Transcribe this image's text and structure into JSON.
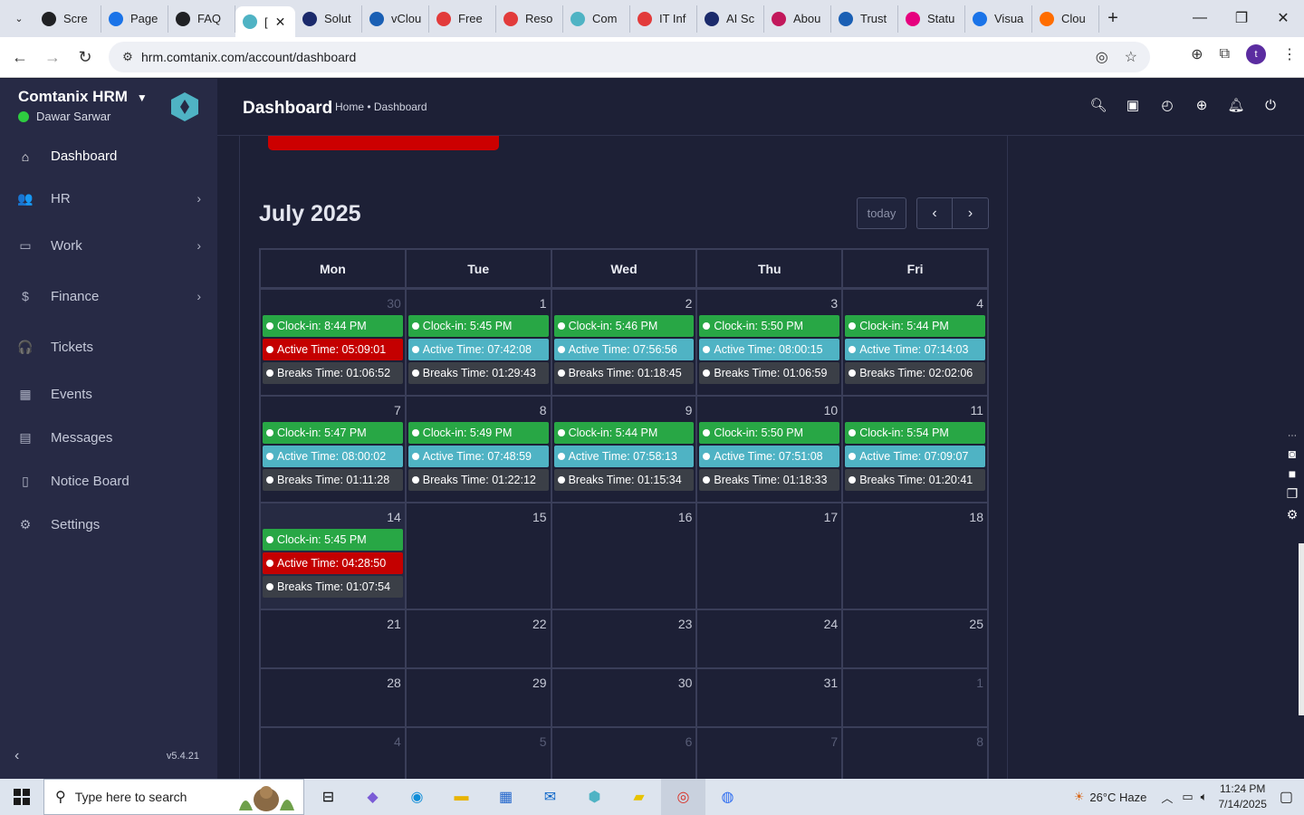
{
  "browser": {
    "tabs": [
      {
        "label": "Scre",
        "color": "#202124"
      },
      {
        "label": "Page",
        "color": "#1a73e8"
      },
      {
        "label": "FAQ",
        "color": "#202124"
      },
      {
        "label": "[",
        "color": "#4fb3c4",
        "active": true
      },
      {
        "label": "Solut",
        "color": "#1b2a6b"
      },
      {
        "label": "vClou",
        "color": "#1a5fb4"
      },
      {
        "label": "Free",
        "color": "#e23b3b"
      },
      {
        "label": "Reso",
        "color": "#e23b3b"
      },
      {
        "label": "Com",
        "color": "#4fb3c4"
      },
      {
        "label": "IT Inf",
        "color": "#e23b3b"
      },
      {
        "label": "AI Sc",
        "color": "#1b2a6b"
      },
      {
        "label": "Abou",
        "color": "#c2185b"
      },
      {
        "label": "Trust",
        "color": "#1a5fb4"
      },
      {
        "label": "Statu",
        "color": "#e6007e"
      },
      {
        "label": "Visua",
        "color": "#1a73e8"
      },
      {
        "label": "Clou",
        "color": "#ff6d00"
      }
    ],
    "url": "hrm.comtanix.com/account/dashboard",
    "profile_initial": "t"
  },
  "sidebar": {
    "brand": "Comtanix HRM",
    "user_name": "Dawar Sarwar",
    "items": [
      {
        "label": "Dashboard",
        "icon": "home-icon",
        "glyph": "⌂",
        "active": true,
        "has_sub": false
      },
      {
        "label": "HR",
        "icon": "users-icon",
        "glyph": "👥",
        "has_sub": true
      },
      {
        "label": "Work",
        "icon": "briefcase-icon",
        "glyph": "▭",
        "has_sub": true
      },
      {
        "label": "Finance",
        "icon": "dollar-icon",
        "glyph": "$",
        "has_sub": true
      },
      {
        "label": "Tickets",
        "icon": "headset-icon",
        "glyph": "🎧",
        "has_sub": false
      },
      {
        "label": "Events",
        "icon": "calendar-icon",
        "glyph": "▦",
        "has_sub": false
      },
      {
        "label": "Messages",
        "icon": "message-icon",
        "glyph": "▤",
        "has_sub": false
      },
      {
        "label": "Notice Board",
        "icon": "clipboard-icon",
        "glyph": "▯",
        "has_sub": false
      },
      {
        "label": "Settings",
        "icon": "gear-icon",
        "glyph": "⚙",
        "has_sub": false
      }
    ],
    "version": "v5.4.21"
  },
  "header": {
    "title": "Dashboard",
    "breadcrumb": "Home • Dashboard"
  },
  "calendar": {
    "title": "July 2025",
    "today_label": "today",
    "weekdays": [
      "Mon",
      "Tue",
      "Wed",
      "Thu",
      "Fri"
    ],
    "weeks": [
      {
        "height": 118,
        "days": [
          {
            "num": "30",
            "other": true,
            "events": [
              {
                "text": "Clock-in: 8:44 PM",
                "color": "green"
              },
              {
                "text": "Active Time: 05:09:01",
                "color": "red"
              },
              {
                "text": "Breaks Time: 01:06:52",
                "color": "dark"
              }
            ]
          },
          {
            "num": "1",
            "events": [
              {
                "text": "Clock-in: 5:45 PM",
                "color": "green"
              },
              {
                "text": "Active Time: 07:42:08",
                "color": "cyan"
              },
              {
                "text": "Breaks Time: 01:29:43",
                "color": "dark"
              }
            ]
          },
          {
            "num": "2",
            "events": [
              {
                "text": "Clock-in: 5:46 PM",
                "color": "green"
              },
              {
                "text": "Active Time: 07:56:56",
                "color": "cyan"
              },
              {
                "text": "Breaks Time: 01:18:45",
                "color": "dark"
              }
            ]
          },
          {
            "num": "3",
            "events": [
              {
                "text": "Clock-in: 5:50 PM",
                "color": "green"
              },
              {
                "text": "Active Time: 08:00:15",
                "color": "cyan"
              },
              {
                "text": "Breaks Time: 01:06:59",
                "color": "dark"
              }
            ]
          },
          {
            "num": "4",
            "events": [
              {
                "text": "Clock-in: 5:44 PM",
                "color": "green"
              },
              {
                "text": "Active Time: 07:14:03",
                "color": "cyan"
              },
              {
                "text": "Breaks Time: 02:02:06",
                "color": "dark"
              }
            ]
          }
        ]
      },
      {
        "height": 118,
        "days": [
          {
            "num": "7",
            "events": [
              {
                "text": "Clock-in: 5:47 PM",
                "color": "green"
              },
              {
                "text": "Active Time: 08:00:02",
                "color": "cyan"
              },
              {
                "text": "Breaks Time: 01:11:28",
                "color": "dark"
              }
            ]
          },
          {
            "num": "8",
            "events": [
              {
                "text": "Clock-in: 5:49 PM",
                "color": "green"
              },
              {
                "text": "Active Time: 07:48:59",
                "color": "cyan"
              },
              {
                "text": "Breaks Time: 01:22:12",
                "color": "dark"
              }
            ]
          },
          {
            "num": "9",
            "events": [
              {
                "text": "Clock-in: 5:44 PM",
                "color": "green"
              },
              {
                "text": "Active Time: 07:58:13",
                "color": "cyan"
              },
              {
                "text": "Breaks Time: 01:15:34",
                "color": "dark"
              }
            ]
          },
          {
            "num": "10",
            "events": [
              {
                "text": "Clock-in: 5:50 PM",
                "color": "green"
              },
              {
                "text": "Active Time: 07:51:08",
                "color": "cyan"
              },
              {
                "text": "Breaks Time: 01:18:33",
                "color": "dark"
              }
            ]
          },
          {
            "num": "11",
            "events": [
              {
                "text": "Clock-in: 5:54 PM",
                "color": "green"
              },
              {
                "text": "Active Time: 07:09:07",
                "color": "cyan"
              },
              {
                "text": "Breaks Time: 01:20:41",
                "color": "dark"
              }
            ]
          }
        ]
      },
      {
        "height": 118,
        "days": [
          {
            "num": "14",
            "today": true,
            "events": [
              {
                "text": "Clock-in: 5:45 PM",
                "color": "green"
              },
              {
                "text": "Active Time: 04:28:50",
                "color": "red"
              },
              {
                "text": "Breaks Time: 01:07:54",
                "color": "dark"
              }
            ]
          },
          {
            "num": "15",
            "events": []
          },
          {
            "num": "16",
            "events": []
          },
          {
            "num": "17",
            "events": []
          },
          {
            "num": "18",
            "events": []
          }
        ]
      },
      {
        "height": 65,
        "days": [
          {
            "num": "21",
            "events": []
          },
          {
            "num": "22",
            "events": []
          },
          {
            "num": "23",
            "events": []
          },
          {
            "num": "24",
            "events": []
          },
          {
            "num": "25",
            "events": []
          }
        ]
      },
      {
        "height": 65,
        "days": [
          {
            "num": "28",
            "events": []
          },
          {
            "num": "29",
            "events": []
          },
          {
            "num": "30",
            "events": []
          },
          {
            "num": "31",
            "events": []
          },
          {
            "num": "1",
            "other": true,
            "events": []
          }
        ]
      },
      {
        "height": 65,
        "days": [
          {
            "num": "4",
            "other": true,
            "events": []
          },
          {
            "num": "5",
            "other": true,
            "events": []
          },
          {
            "num": "6",
            "other": true,
            "events": []
          },
          {
            "num": "7",
            "other": true,
            "events": []
          },
          {
            "num": "8",
            "other": true,
            "events": []
          }
        ]
      }
    ]
  },
  "taskbar": {
    "search_placeholder": "Type here to search",
    "weather": "26°C  Haze",
    "time": "11:24 PM",
    "date": "7/14/2025"
  }
}
